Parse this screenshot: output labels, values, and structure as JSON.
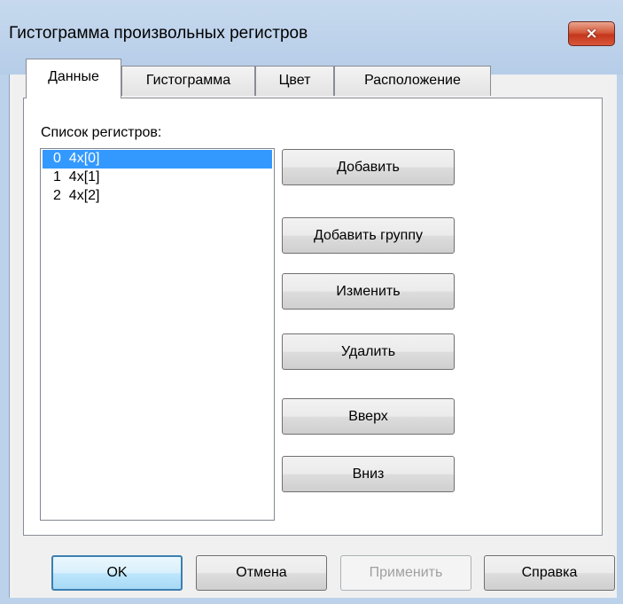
{
  "window": {
    "title": "Гистограмма произвольных регистров",
    "close_glyph": "×"
  },
  "tabs": [
    {
      "label": "Данные",
      "active": true
    },
    {
      "label": "Гистограмма",
      "active": false
    },
    {
      "label": "Цвет",
      "active": false
    },
    {
      "label": "Расположение",
      "active": false
    }
  ],
  "panel": {
    "list_label": "Список регистров:",
    "registers": [
      {
        "text": "0  4x[0]",
        "selected": true
      },
      {
        "text": "1  4x[1]",
        "selected": false
      },
      {
        "text": "2  4x[2]",
        "selected": false
      }
    ],
    "buttons": {
      "add": "Добавить",
      "add_group": "Добавить группу",
      "edit": "Изменить",
      "delete": "Удалить",
      "up": "Вверх",
      "down": "Вниз"
    }
  },
  "footer": {
    "ok": "OK",
    "cancel": "Отмена",
    "apply": "Применить",
    "help": "Справка"
  },
  "colors": {
    "selection": "#3399ff",
    "titlebar": "#b9d1ea",
    "close_button": "#c7452a"
  }
}
